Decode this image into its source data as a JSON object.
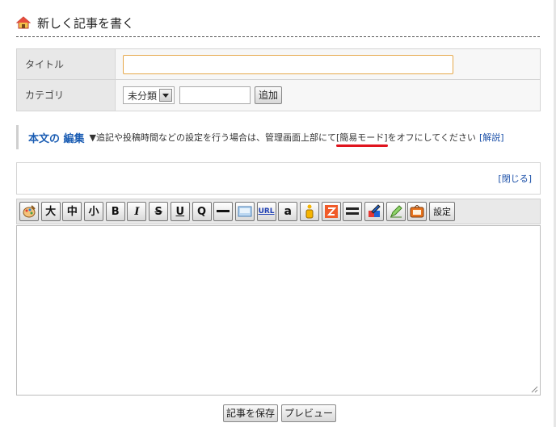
{
  "page": {
    "title": "新しく記事を書く",
    "icon": "home-icon"
  },
  "form": {
    "title_label": "タイトル",
    "title_value": "",
    "category_label": "カテゴリ",
    "category_selected": "未分類",
    "category_new_value": "",
    "add_button": "追加"
  },
  "body_heading": {
    "title": "本文の 編集",
    "note_prefix": "▼追記や投稿時間などの設定を行う場合は、管理画面上部にて",
    "mode_label": "[簡易モード]",
    "note_suffix": "をオフにしてください",
    "help_link": "[解説]",
    "highlight_color": "#e0141e"
  },
  "panel": {
    "close_link": "[閉じる]"
  },
  "toolbar": {
    "buttons": [
      {
        "icon": "palette-icon"
      },
      {
        "label": "大"
      },
      {
        "label": "中"
      },
      {
        "label": "小"
      },
      {
        "label": "B"
      },
      {
        "label": "I"
      },
      {
        "label": "S"
      },
      {
        "label": "U"
      },
      {
        "label": "Q"
      },
      {
        "icon": "horizontal-rule-icon"
      },
      {
        "icon": "image-icon"
      },
      {
        "label": "URL"
      },
      {
        "label": "a"
      },
      {
        "icon": "info-icon"
      },
      {
        "icon": "zoom-icon"
      },
      {
        "icon": "more-icon"
      },
      {
        "icon": "color-icon"
      },
      {
        "icon": "pen-icon"
      },
      {
        "icon": "tv-icon"
      },
      {
        "label": "設定"
      }
    ]
  },
  "editor": {
    "value": ""
  },
  "actions": {
    "save": "記事を保存",
    "preview": "プレビュー"
  }
}
